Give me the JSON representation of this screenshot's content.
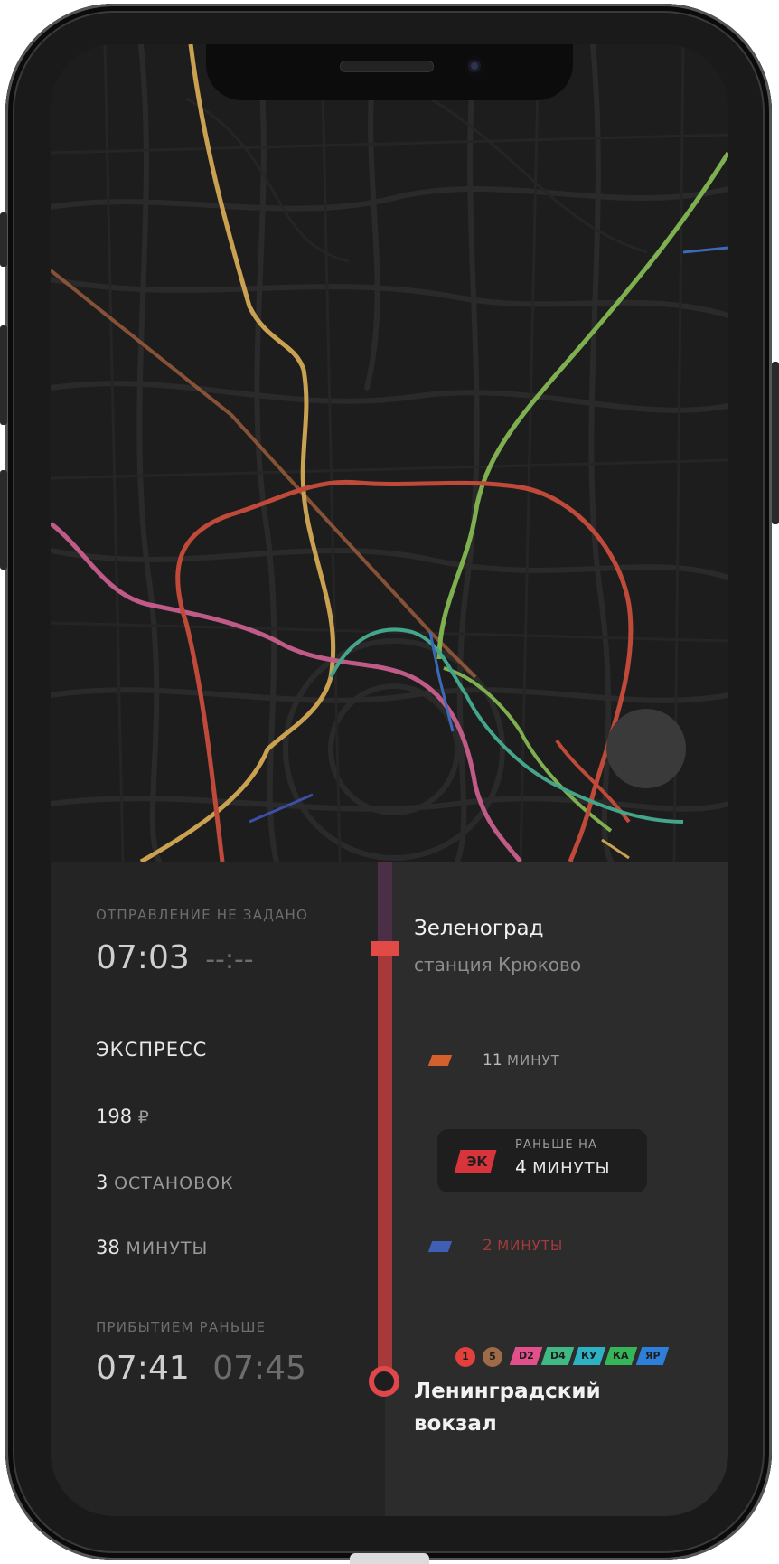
{
  "departure": {
    "label": "ОТПРАВЛЕНИЕ НЕ ЗАДАНО",
    "time": "07:03",
    "time_placeholder": "--:--"
  },
  "train": {
    "type": "ЭКСПРЕСС",
    "price_value": "198",
    "price_currency": "₽",
    "stops_value": "3",
    "stops_unit": "ОСТАНОВОК",
    "duration_value": "38",
    "duration_unit": "МИНУТЫ"
  },
  "arrival": {
    "label": "ПРИБЫТИЕМ РАНЬШЕ",
    "time_primary": "07:41",
    "time_secondary": "07:45"
  },
  "origin": {
    "name": "Зеленоград",
    "station": "станция Крюково"
  },
  "options": [
    {
      "value": "11",
      "unit": "МИНУТ",
      "color": "#d4602e"
    },
    {
      "badge": "ЭК",
      "label": "РАНЬШЕ НА",
      "value": "4",
      "unit": "МИНУТЫ",
      "color": "#d8343b"
    },
    {
      "value": "2",
      "unit": "МИНУТЫ",
      "color": "#3f5fb5",
      "text_color": "#a33a3a"
    }
  ],
  "destination": {
    "name_line1": "Ленинградский",
    "name_line2": "вокзал",
    "lines": [
      {
        "label": "1",
        "shape": "circle",
        "color": "#e2403d"
      },
      {
        "label": "5",
        "shape": "circle",
        "color": "#9e6a48"
      },
      {
        "label": "D2",
        "shape": "para",
        "color": "#e0508a"
      },
      {
        "label": "D4",
        "shape": "para",
        "color": "#40b883"
      },
      {
        "label": "КУ",
        "shape": "para",
        "color": "#2cb2c3"
      },
      {
        "label": "КА",
        "shape": "para",
        "color": "#36b45a"
      },
      {
        "label": "ЯР",
        "shape": "para",
        "color": "#2d7fd9"
      }
    ]
  },
  "colors": {
    "accent": "#e24a45",
    "timeline": "#a8393b",
    "timeline_past": "#4b2f46"
  }
}
